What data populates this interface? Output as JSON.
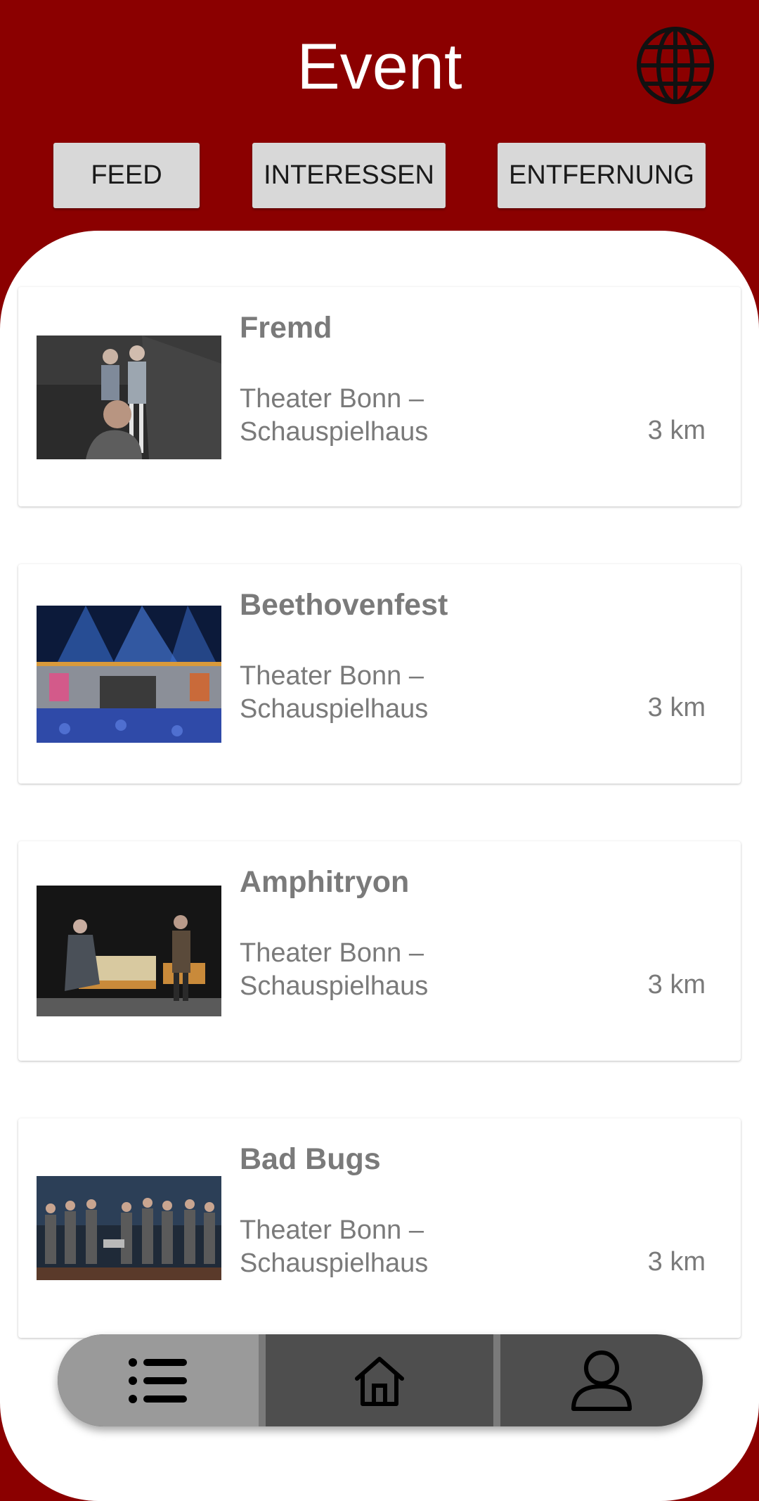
{
  "header": {
    "title": "Event",
    "language_icon": "globe-icon"
  },
  "tabs": [
    {
      "label": "FEED"
    },
    {
      "label": "INTERESSEN"
    },
    {
      "label": "ENTFERNUNG"
    }
  ],
  "events": [
    {
      "title": "Fremd",
      "venue": "Theater Bonn – Schauspielhaus",
      "distance": "3 km"
    },
    {
      "title": "Beethovenfest",
      "venue": "Theater Bonn – Schauspielhaus",
      "distance": "3 km"
    },
    {
      "title": "Amphitryon",
      "venue": "Theater Bonn – Schauspielhaus",
      "distance": "3 km"
    },
    {
      "title": "Bad Bugs",
      "venue": "Theater Bonn – Schauspielhaus",
      "distance": "3 km"
    }
  ],
  "bottom_nav": [
    {
      "icon": "list-icon",
      "active": true
    },
    {
      "icon": "home-icon",
      "active": false
    },
    {
      "icon": "user-icon",
      "active": false
    }
  ],
  "colors": {
    "brand": "#8b0000",
    "tab_bg": "#d8d8d8",
    "nav_active": "#9a9a9a",
    "nav_inactive": "#4e4e4e",
    "text_muted": "#7a7a7a"
  }
}
